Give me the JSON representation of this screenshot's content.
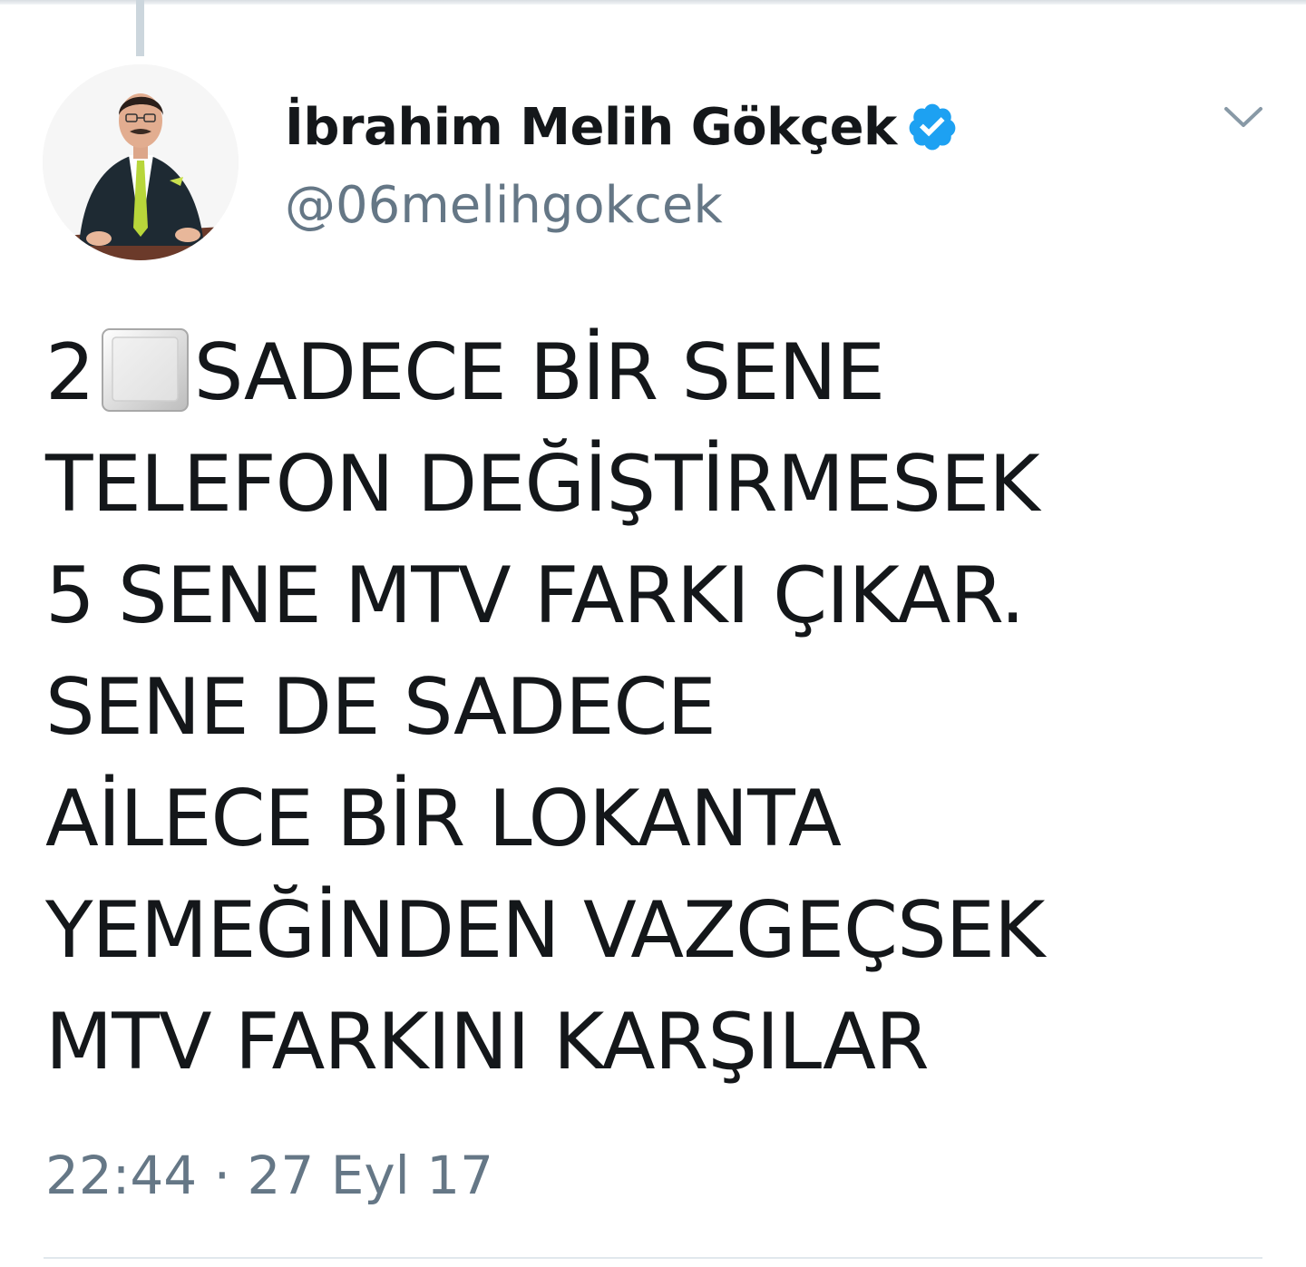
{
  "tweet": {
    "display_name": "İbrahim Melih Gökçek",
    "handle": "@06melihgokcek",
    "text_lines": [
      {
        "before_icon": "2",
        "icon": "keycap-blank-icon",
        "after_icon": "SADECE BİR SENE"
      },
      "TELEFON DEĞİŞTİRMESEK",
      "5 SENE MTV FARKI ÇIKAR.",
      "SENE DE SADECE",
      "AİLECE BİR LOKANTA",
      "YEMEĞİNDEN VAZGEÇSEK",
      "MTV FARKINI KARŞILAR"
    ],
    "timestamp": "22:44 · 27 Eyl 17"
  },
  "icons": {
    "verified": "verified-badge-icon",
    "menu": "chevron-down-icon",
    "avatar": "profile-photo"
  },
  "colors": {
    "verified_blue": "#1da1f2",
    "text_primary": "#14171a",
    "text_secondary": "#657786",
    "thread_line": "#ccd6dd",
    "divider": "#e1e8ed"
  }
}
